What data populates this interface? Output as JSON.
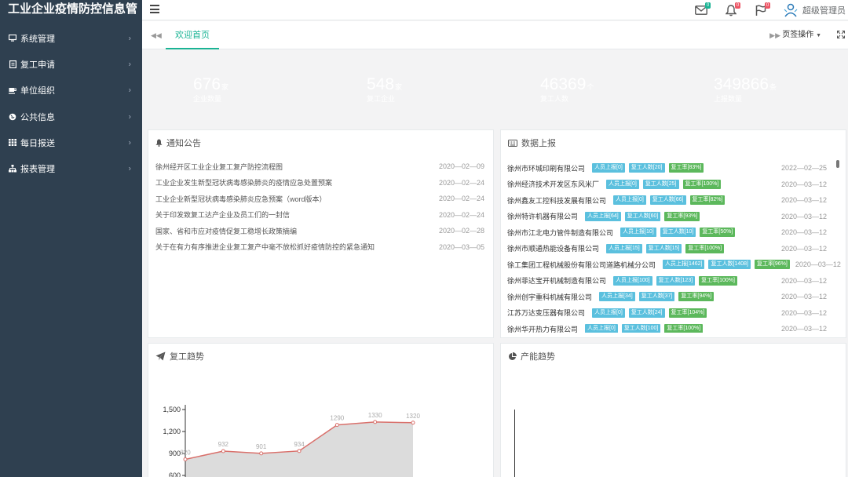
{
  "app": {
    "title": "工业企业疫情防控信息管"
  },
  "sidebar": {
    "items": [
      {
        "label": "系统管理",
        "icon": "monitor-icon"
      },
      {
        "label": "复工申请",
        "icon": "document-icon"
      },
      {
        "label": "单位组织",
        "icon": "coffee-icon"
      },
      {
        "label": "公共信息",
        "icon": "globe-icon"
      },
      {
        "label": "每日报送",
        "icon": "grid-icon"
      },
      {
        "label": "报表管理",
        "icon": "sitemap-icon"
      }
    ]
  },
  "topbar": {
    "mail_badge": "0",
    "bell_badge": "0",
    "flag_badge": "0",
    "user_name": "超级管理员"
  },
  "tabs": {
    "active_label": "欢迎首页",
    "ops_label": "页签操作"
  },
  "stats": [
    {
      "value": "676",
      "unit": "家",
      "caption": "企业数量",
      "color": "#1c84f3"
    },
    {
      "value": "548",
      "unit": "家",
      "caption": "复工企业",
      "color": "#d9706b"
    },
    {
      "value": "46369",
      "unit": "个",
      "caption": "复工人数",
      "color": "#7a7cf2"
    },
    {
      "value": "349866",
      "unit": "条",
      "caption": "上报数量",
      "color": "#4ad58a"
    }
  ],
  "notice": {
    "title": "通知公告",
    "items": [
      {
        "title": "徐州经开区工业企业复工复产防控流程图",
        "date": "2020—02—09"
      },
      {
        "title": "工业企业发生新型冠状病毒感染肺炎的疫情应急处置预案",
        "date": "2020—02—24"
      },
      {
        "title": "工业企业新型冠状病毒感染肺炎应急预案（word版本）",
        "date": "2020—02—24"
      },
      {
        "title": "关于印发致复工达产企业及员工们的一封信",
        "date": "2020—02—24"
      },
      {
        "title": "国家、省和市应对疫情促复工稳增长政策摘编",
        "date": "2020—02—28"
      },
      {
        "title": "关于在有力有序推进企业复工复产中毫不放松抓好疫情防控的紧急通知",
        "date": "2020—03—05"
      }
    ]
  },
  "report": {
    "title": "数据上报",
    "items": [
      {
        "name": "徐州市环城印刷有限公司",
        "reported": "人员上报[0]",
        "workers": "复工人数[20]",
        "rate": "复工率[83%]",
        "date": "2022—02—25"
      },
      {
        "name": "徐州经济技术开发区东风米厂",
        "reported": "人员上报[0]",
        "workers": "复工人数[25]",
        "rate": "复工率[100%]",
        "date": "2020—03—12"
      },
      {
        "name": "徐州鑫友工控科技发展有限公司",
        "reported": "人员上报[0]",
        "workers": "复工人数[66]",
        "rate": "复工率[82%]",
        "date": "2020—03—12"
      },
      {
        "name": "徐州特许机器有限公司",
        "reported": "人员上报[64]",
        "workers": "复工人数[60]",
        "rate": "复工率[93%]",
        "date": "2020—03—12"
      },
      {
        "name": "徐州市江北电力管件制造有限公司",
        "reported": "人员上报[10]",
        "workers": "复工人数[10]",
        "rate": "复工率[50%]",
        "date": "2020—03—12"
      },
      {
        "name": "徐州市顺通热能设备有限公司",
        "reported": "人员上报[15]",
        "workers": "复工人数[15]",
        "rate": "复工率[100%]",
        "date": "2020—03—12"
      },
      {
        "name": "徐工集团工程机械股份有限公司道路机械分公司",
        "reported": "人员上报[1462]",
        "workers": "复工人数[1408]",
        "rate": "复工率[96%]",
        "date": "2020—03—12"
      },
      {
        "name": "徐州菲达宝开机械制造有限公司",
        "reported": "人员上报[100]",
        "workers": "复工人数[123]",
        "rate": "复工率[100%]",
        "date": "2020—03—12"
      },
      {
        "name": "徐州创宇重科机械有限公司",
        "reported": "人员上报[34]",
        "workers": "复工人数[37]",
        "rate": "复工率[94%]",
        "date": "2020—03—12"
      },
      {
        "name": "江苏万达变压器有限公司",
        "reported": "人员上报[0]",
        "workers": "复工人数[24]",
        "rate": "复工率[104%]",
        "date": "2020—03—12"
      },
      {
        "name": "徐州华开热力有限公司",
        "reported": "人员上报[0]",
        "workers": "复工人数[100]",
        "rate": "复工率[100%]",
        "date": "2020—03—12"
      }
    ],
    "colors": {
      "reported": "#5bc0de",
      "workers": "#5bc0de",
      "rate": "#5cb85c"
    }
  },
  "trend": {
    "title": "复工趋势"
  },
  "capacity": {
    "title": "产能趋势"
  },
  "chart_data": {
    "type": "area",
    "values": [
      820,
      932,
      901,
      934,
      1290,
      1330,
      1320
    ],
    "yticks": [
      "1,500",
      "1,200",
      "900",
      "600"
    ],
    "ylim": [
      600,
      1500
    ],
    "line_color": "#d9706b",
    "fill_color": "#dcdcdc"
  }
}
